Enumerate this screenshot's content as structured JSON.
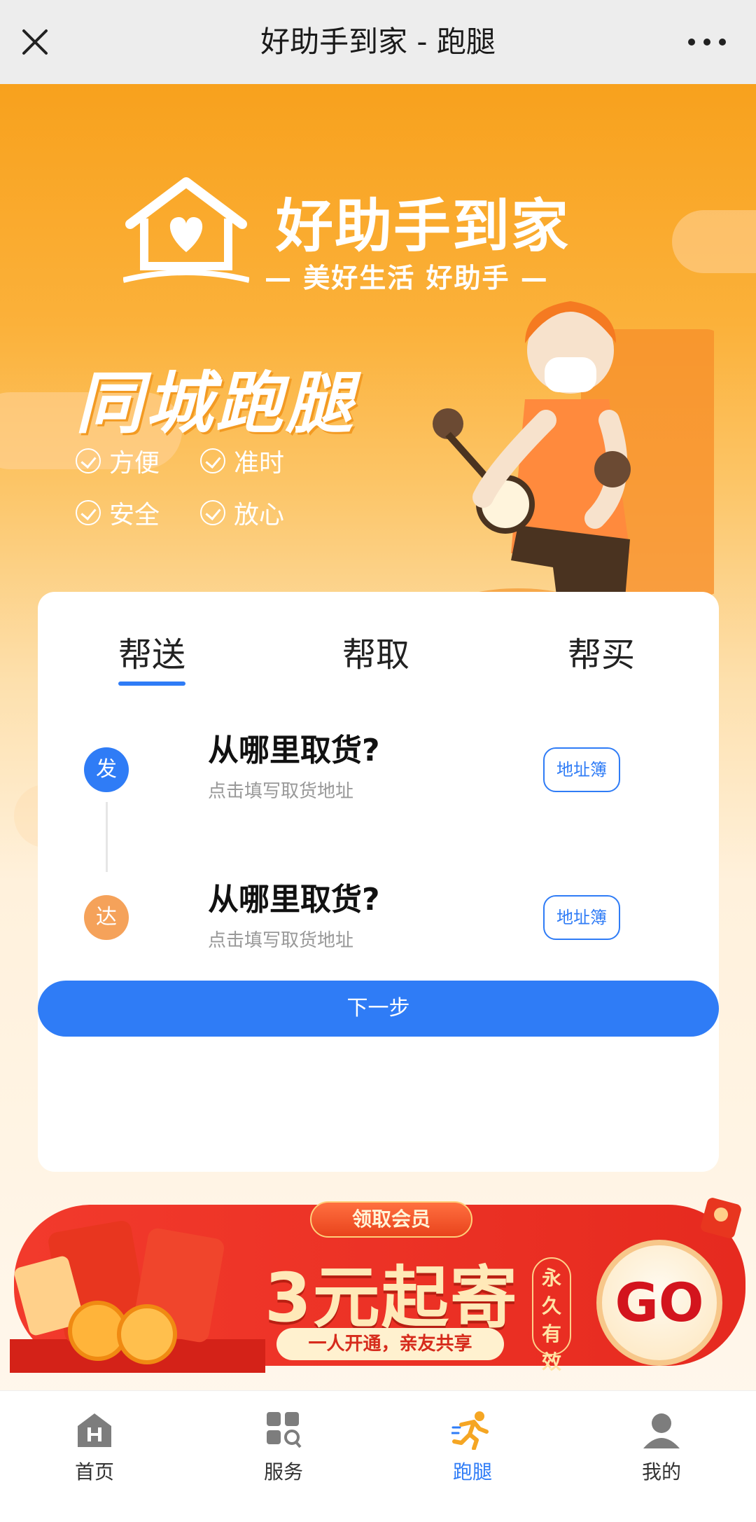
{
  "topbar": {
    "title": "好助手到家 - 跑腿"
  },
  "hero": {
    "brand": "好助手到家",
    "slogan": "— 美好生活  好助手 —",
    "title": "同城跑腿",
    "features": [
      "方便",
      "准时",
      "安全",
      "放心"
    ]
  },
  "tabs": [
    "帮送",
    "帮取",
    "帮买"
  ],
  "rows": [
    {
      "badge": "发",
      "question": "从哪里取货?",
      "hint": "点击填写取货地址",
      "button": "地址簿"
    },
    {
      "badge": "达",
      "question": "从哪里取货?",
      "hint": "点击填写取货地址",
      "button": "地址簿"
    }
  ],
  "next_button": "下一步",
  "promo": {
    "tag": "领取会员",
    "main": "3元起寄",
    "sub": "一人开通，亲友共享",
    "vertical": "永久有效",
    "go": "GO"
  },
  "nav": [
    {
      "label": "首页",
      "icon": "home-icon"
    },
    {
      "label": "服务",
      "icon": "grid-search-icon"
    },
    {
      "label": "跑腿",
      "icon": "runner-icon",
      "active": true
    },
    {
      "label": "我的",
      "icon": "user-icon"
    }
  ],
  "colors": {
    "accent": "#2f7cf6",
    "orange": "#f8a11d",
    "promo_red": "#e62a1f"
  }
}
